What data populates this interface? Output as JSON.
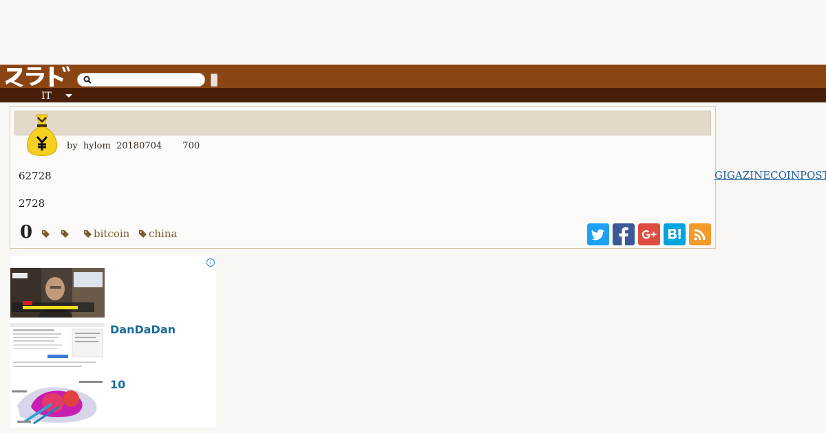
{
  "header": {
    "logo_text": "スラド",
    "search_placeholder": "",
    "search_value": "",
    "section_label": "IT"
  },
  "article": {
    "title": "",
    "byline_by": "by",
    "author": "hylom",
    "date": "20180704",
    "count": "700",
    "paragraph1": "62728",
    "paragraph2": "2728",
    "comments_count": "0",
    "tags": [
      "",
      "",
      "bitcoin",
      "china"
    ]
  },
  "external_links": {
    "link1": "GIGAZINE",
    "link2": "COINPOST"
  },
  "share": {
    "colors": {
      "twitter": "#1da1f2",
      "facebook": "#3b5998",
      "googleplus": "#dc4e41",
      "hatena": "#00a4de",
      "rss": "#f39a2b"
    }
  },
  "ad": {
    "items": [
      {
        "title": ""
      },
      {
        "title": "DanDaDan"
      },
      {
        "title": "10"
      }
    ],
    "info_icon": "i"
  },
  "colors": {
    "header_brown": "#8b4513",
    "subnav_dark": "#4a1f0a",
    "title_bar": "#e3d9cb"
  }
}
